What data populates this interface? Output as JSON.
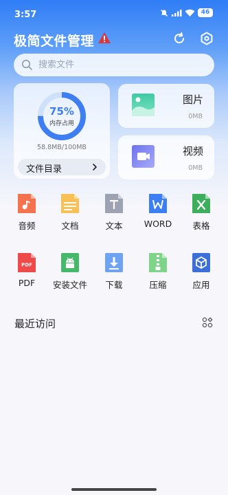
{
  "status_bar": {
    "time": "3:57",
    "battery": "46"
  },
  "header": {
    "title": "极简文件管理"
  },
  "search": {
    "placeholder": "搜索文件"
  },
  "storage": {
    "percent": "75%",
    "label": "内存占用",
    "size": "58.8MB/100MB",
    "directory_label": "文件目录",
    "used_fraction": 0.75
  },
  "media": {
    "images": {
      "title": "图片",
      "size": "0MB"
    },
    "videos": {
      "title": "视频",
      "size": "0MB"
    }
  },
  "categories": [
    {
      "label": "音频",
      "icon": "audio-file-icon"
    },
    {
      "label": "文档",
      "icon": "document-file-icon"
    },
    {
      "label": "文本",
      "icon": "text-file-icon"
    },
    {
      "label": "WORD",
      "icon": "word-file-icon"
    },
    {
      "label": "表格",
      "icon": "excel-file-icon"
    },
    {
      "label": "PDF",
      "icon": "pdf-file-icon"
    },
    {
      "label": "安装文件",
      "icon": "android-apk-icon"
    },
    {
      "label": "下载",
      "icon": "download-icon"
    },
    {
      "label": "压缩",
      "icon": "zip-file-icon"
    },
    {
      "label": "应用",
      "icon": "app-cube-icon"
    }
  ],
  "recent": {
    "title": "最近访问"
  },
  "colors": {
    "accent": "#3e7ef0",
    "brand_blue": "#2f7df6"
  }
}
